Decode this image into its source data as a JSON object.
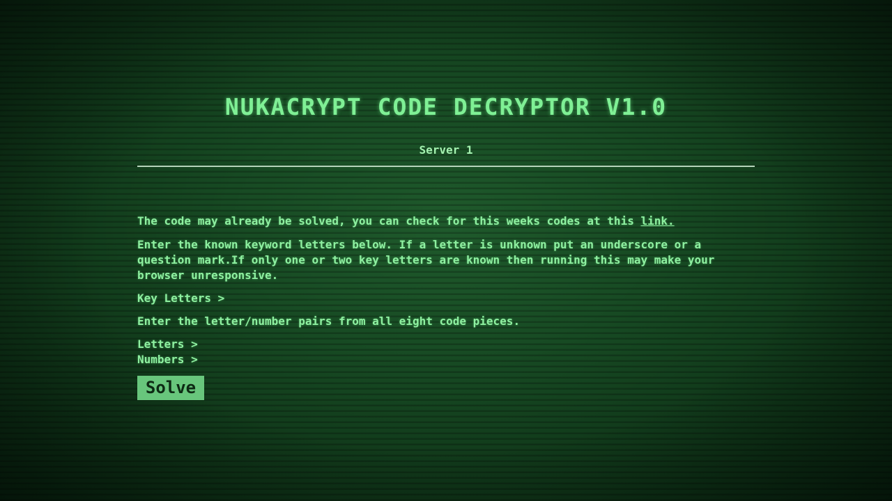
{
  "header": {
    "title": "NUKACRYPT CODE DECRYPTOR V1.0",
    "server": "Server 1"
  },
  "intro": {
    "text": "The code may already be solved, you can check for this weeks codes at this",
    "link_label": "link."
  },
  "instructions": "Enter the known keyword letters below. If a letter is unknown put an underscore or a question mark.If only one or two key letters are known then running this may make your browser unresponsive.",
  "key_letters_label": "Key Letters >",
  "pairs_instruction": "Enter the letter/number pairs from all eight code pieces.",
  "letters_label": "Letters >",
  "numbers_label": "Numbers >",
  "solve_label": "Solve",
  "colors": {
    "text": "#8ef0a0",
    "button_bg": "#68c67c",
    "background": "#174a23"
  }
}
